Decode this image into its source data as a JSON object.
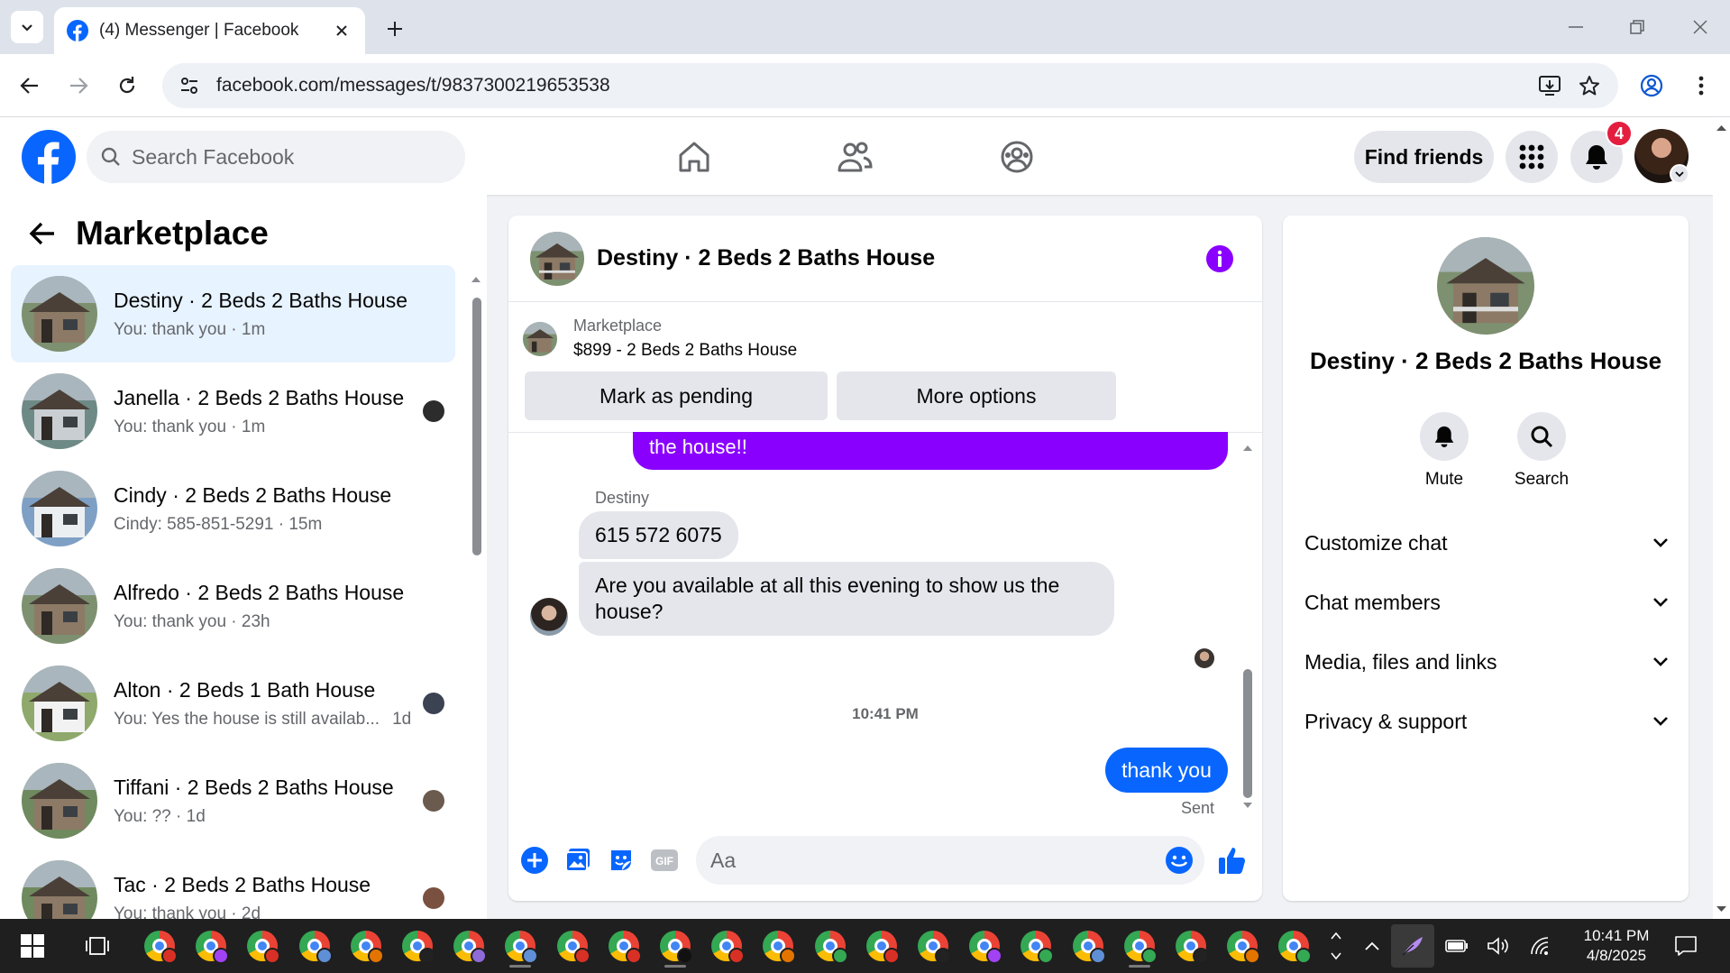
{
  "browser": {
    "tab_title": "(4) Messenger | Facebook",
    "url": "facebook.com/messages/t/9837300219653538"
  },
  "fb": {
    "search_placeholder": "Search Facebook",
    "find_friends": "Find friends",
    "notification_count": "4",
    "brand_color": "#0866ff"
  },
  "sidebar": {
    "title": "Marketplace",
    "conversations": [
      {
        "name": "Destiny · 2 Beds 2 Baths House",
        "sub": "You: thank you · 1m",
        "active": true
      },
      {
        "name": "Janella · 2 Beds 2 Baths House",
        "sub": "You: thank you · 1m"
      },
      {
        "name": "Cindy · 2 Beds 2 Baths House",
        "sub": "Cindy: 585-851-5291 · 15m"
      },
      {
        "name": "Alfredo · 2 Beds 2 Baths House",
        "sub": "You: thank you · 23h"
      },
      {
        "name": "Alton · 2 Beds 1 Bath House",
        "sub": "You: Yes the house is still availab...",
        "time": "1d"
      },
      {
        "name": "Tiffani · 2 Beds 2 Baths House",
        "sub": "You: ?? · 1d"
      },
      {
        "name": "Tac · 2 Beds 2 Baths House",
        "sub": "You: thank you · 2d"
      }
    ]
  },
  "chat": {
    "title": "Destiny · 2 Beds 2 Baths House",
    "marketplace_label": "Marketplace",
    "listing": "$899 - 2 Beds 2 Baths House",
    "mark_pending": "Mark as pending",
    "more_options": "More options",
    "messages": {
      "out_prev": "the house!!",
      "sender": "Destiny",
      "in_1": "615 572 6075",
      "in_2": "Are you available at all this evening to show us the house?",
      "timestamp": "10:41 PM",
      "out_last": "thank you",
      "status": "Sent"
    },
    "composer_placeholder": "Aa"
  },
  "info_panel": {
    "name": "Destiny · 2 Beds 2 Baths House",
    "mute": "Mute",
    "search": "Search",
    "sections": [
      "Customize chat",
      "Chat members",
      "Media, files and links",
      "Privacy & support"
    ]
  },
  "taskbar": {
    "time": "10:41 PM",
    "date": "4/8/2025"
  }
}
